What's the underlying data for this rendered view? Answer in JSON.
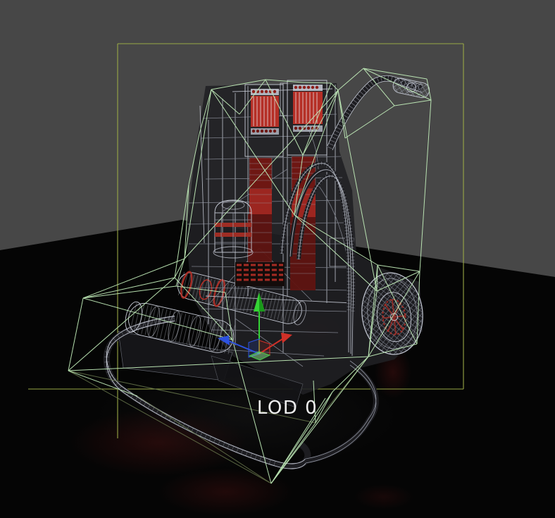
{
  "viewport": {
    "lod_label": "LOD 0"
  },
  "colors": {
    "background": "#474747",
    "floor": "#050505",
    "bounds-box": "#99a845",
    "collision-mesh": "#c0ebb8",
    "collision-dim": "#6f7f52",
    "wire": "#c7cbd6",
    "wire-dark": "#8e929e",
    "model-fill": "#202024",
    "accent-red": "#b52f26",
    "accent-red-dark": "#6e1713",
    "gizmo-x": "#d03028",
    "gizmo-y": "#35d435",
    "gizmo-z": "#2d52e0",
    "label": "#ededed"
  }
}
